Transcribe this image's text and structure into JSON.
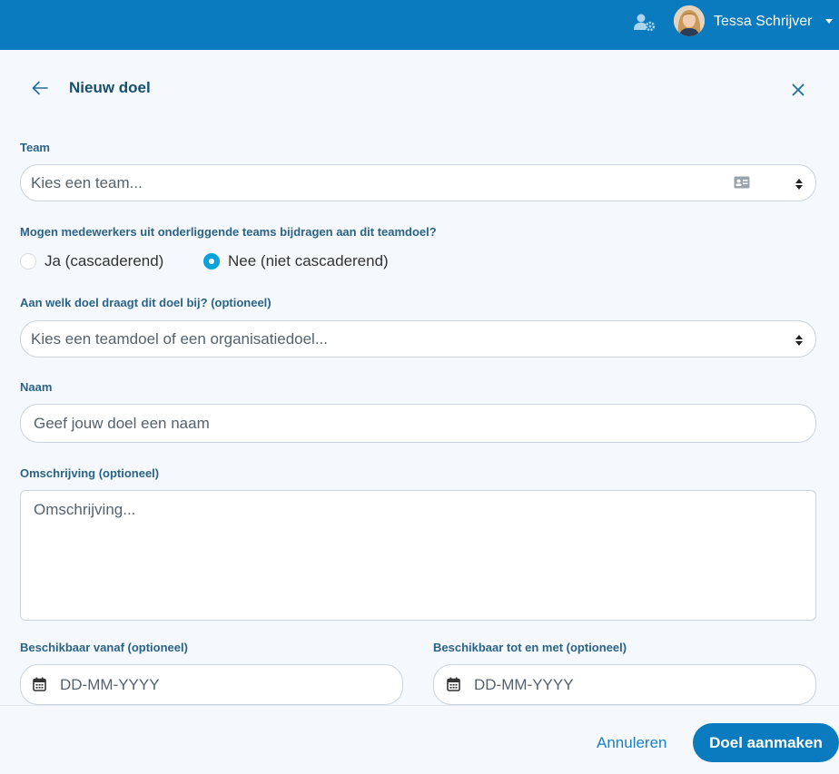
{
  "header": {
    "user_name": "Tessa Schrijver",
    "accent_color": "#0a7bbf",
    "icons": [
      "user-gear-icon",
      "avatar",
      "caret-down-icon"
    ]
  },
  "page": {
    "title": "Nieuw doel",
    "back_icon": "arrow-left-icon",
    "close_icon": "close-icon"
  },
  "form": {
    "team": {
      "label": "Team",
      "placeholder": "Kies een team...",
      "icon": "id-card-icon"
    },
    "cascade": {
      "question": "Mogen medewerkers uit onderliggende teams bijdragen aan dit teamdoel?",
      "options": [
        {
          "label": "Ja (cascaderend)",
          "selected": false
        },
        {
          "label": "Nee (niet cascaderend)",
          "selected": true
        }
      ]
    },
    "parent_goal": {
      "label": "Aan welk doel draagt dit doel bij? (optioneel)",
      "placeholder": "Kies een teamdoel of een organisatiedoel..."
    },
    "name": {
      "label": "Naam",
      "placeholder": "Geef jouw doel een naam"
    },
    "description": {
      "label": "Omschrijving (optioneel)",
      "placeholder": "Omschrijving..."
    },
    "available_from": {
      "label": "Beschikbaar vanaf (optioneel)",
      "placeholder": "DD-MM-YYYY"
    },
    "available_until": {
      "label": "Beschikbaar tot en met (optioneel)",
      "placeholder": "DD-MM-YYYY"
    }
  },
  "footer": {
    "cancel_label": "Annuleren",
    "submit_label": "Doel aanmaken"
  }
}
